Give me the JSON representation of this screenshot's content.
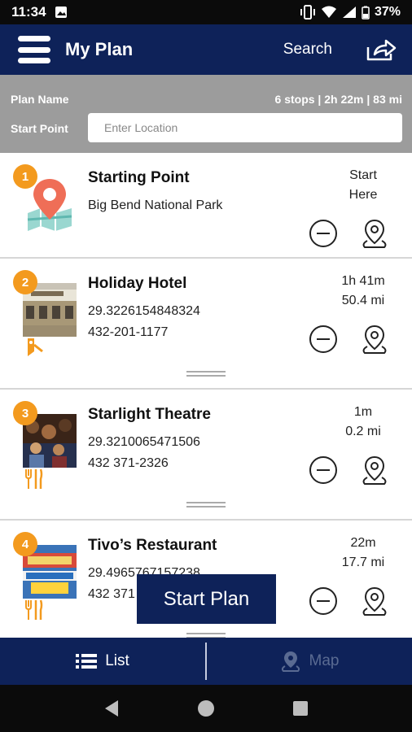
{
  "status_bar": {
    "time": "11:34",
    "battery": "37%"
  },
  "app_bar": {
    "title": "My Plan",
    "search_label": "Search"
  },
  "plan": {
    "name_label": "Plan Name",
    "stats": "6 stops | 2h 22m | 83 mi",
    "start_label": "Start Point",
    "start_placeholder": "Enter Location"
  },
  "stops": [
    {
      "number": "1",
      "name": "Starting Point",
      "line1": "Big Bend National Park",
      "line2": "",
      "time": "Start",
      "distance": "Here",
      "category": "map-pin"
    },
    {
      "number": "2",
      "name": "Holiday Hotel",
      "line1": "29.3226154848324",
      "line2": "432-201-1177",
      "time": "1h 41m",
      "distance": "50.4 mi",
      "category": "hotel"
    },
    {
      "number": "3",
      "name": "Starlight Theatre",
      "line1": "29.3210065471506",
      "line2": "432 371-2326",
      "time": "1m",
      "distance": "0.2 mi",
      "category": "restaurant"
    },
    {
      "number": "4",
      "name": "Tivo’s Restaurant",
      "line1": "29.4965767157238",
      "line2": "432 371",
      "time": "22m",
      "distance": "17.7 mi",
      "category": "restaurant"
    }
  ],
  "start_plan_label": "Start Plan",
  "tabs": {
    "list": "List",
    "map": "Map"
  },
  "colors": {
    "primary": "#0e2259",
    "badge": "#f39a1e",
    "header_gray": "#9c9c9c"
  }
}
